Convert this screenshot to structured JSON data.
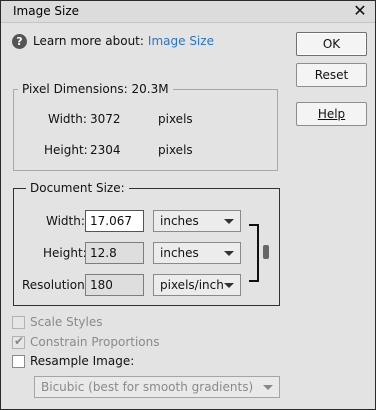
{
  "window": {
    "title": "Image Size"
  },
  "help": {
    "learn_text": "Learn more about:",
    "learn_link": "Image Size"
  },
  "buttons": {
    "ok": "OK",
    "reset": "Reset",
    "help": "Help"
  },
  "pixel_dimensions": {
    "legend": "Pixel Dimensions:",
    "size": "20.3M",
    "width_label": "Width:",
    "width_value": "3072",
    "width_unit": "pixels",
    "height_label": "Height:",
    "height_value": "2304",
    "height_unit": "pixels"
  },
  "document_size": {
    "legend": "Document Size:",
    "width_label": "Width:",
    "width_value": "17.067",
    "width_unit": "inches",
    "height_label": "Height:",
    "height_value": "12.8",
    "height_unit": "inches",
    "resolution_label": "Resolution:",
    "resolution_value": "180",
    "resolution_unit": "pixels/inch"
  },
  "options": {
    "scale_styles": "Scale Styles",
    "constrain_proportions": "Constrain Proportions",
    "resample_image": "Resample Image:",
    "resample_method": "Bicubic (best for smooth gradients)"
  },
  "icons": {
    "close": "close-icon",
    "help": "help-icon",
    "link": "link-chain-icon"
  }
}
